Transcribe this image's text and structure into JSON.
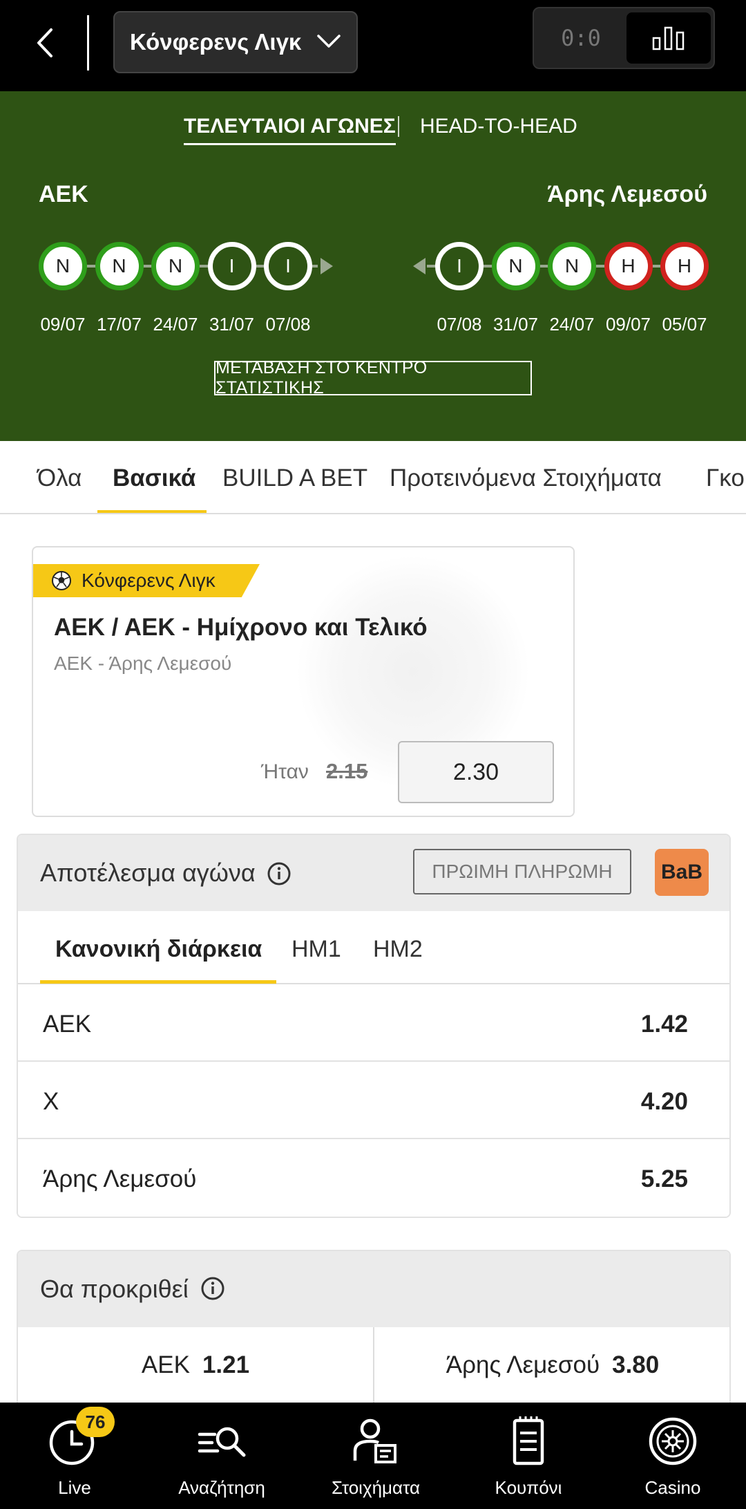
{
  "topbar": {
    "league": "Κόνφερενς Λιγκ",
    "score_toggle": "0:0"
  },
  "stats_panel": {
    "tabs": [
      "ΤΕΛΕΥΤΑΙΟΙ ΑΓΩΝΕΣ",
      "HEAD-TO-HEAD"
    ],
    "home_team": "ΑΕΚ",
    "away_team": "Άρης Λεμεσού",
    "home_form": [
      {
        "result": "N",
        "status": "win",
        "date": "09/07"
      },
      {
        "result": "N",
        "status": "win",
        "date": "17/07"
      },
      {
        "result": "N",
        "status": "win",
        "date": "24/07"
      },
      {
        "result": "I",
        "status": "draw",
        "date": "31/07"
      },
      {
        "result": "I",
        "status": "draw",
        "date": "07/08"
      }
    ],
    "away_form": [
      {
        "result": "I",
        "status": "draw",
        "date": "07/08"
      },
      {
        "result": "N",
        "status": "win",
        "date": "31/07"
      },
      {
        "result": "N",
        "status": "win",
        "date": "24/07"
      },
      {
        "result": "H",
        "status": "loss",
        "date": "09/07"
      },
      {
        "result": "H",
        "status": "loss",
        "date": "05/07"
      }
    ],
    "stats_link": "ΜΕΤΑΒΑΣΗ ΣΤΟ ΚΕΝΤΡΟ ΣΤΑΤΙΣΤΙΚΗΣ"
  },
  "market_tabs": [
    "Όλα",
    "Βασικά",
    "BUILD A BET",
    "Προτεινόμενα Στοιχήματα",
    "Γκο"
  ],
  "promo": {
    "league": "Κόνφερενς Λιγκ",
    "title": "ΑΕΚ / ΑΕΚ - Ημίχρονο και Τελικό",
    "match": "ΑΕΚ - Άρης Λεμεσού",
    "was_label": "Ήταν",
    "old_odds": "2.15",
    "odds": "2.30"
  },
  "match_result": {
    "title": "Αποτέλεσμα αγώνα",
    "early_payout": "ΠΡΩΙΜΗ ΠΛΗΡΩΜΗ",
    "bab": "BaB",
    "subtabs": [
      "Κανονική διάρκεια",
      "ΗΜ1",
      "ΗΜ2"
    ],
    "rows": [
      {
        "label": "ΑΕΚ",
        "odds": "1.42"
      },
      {
        "label": "Χ",
        "odds": "4.20"
      },
      {
        "label": "Άρης Λεμεσού",
        "odds": "5.25"
      }
    ]
  },
  "qualify": {
    "title": "Θα προκριθεί",
    "options": [
      {
        "label": "ΑΕΚ",
        "odds": "1.21"
      },
      {
        "label": "Άρης Λεμεσού",
        "odds": "3.80"
      }
    ]
  },
  "bottom_nav": {
    "items": [
      "Live",
      "Αναζήτηση",
      "Στοιχήματα",
      "Κουπόνι",
      "Casino"
    ],
    "live_badge": "76"
  },
  "colors": {
    "accent": "#f6c816",
    "panel_green": "#2e5314",
    "win": "#2f9e1b",
    "loss": "#d0231e",
    "bab": "#ee8a4a"
  }
}
